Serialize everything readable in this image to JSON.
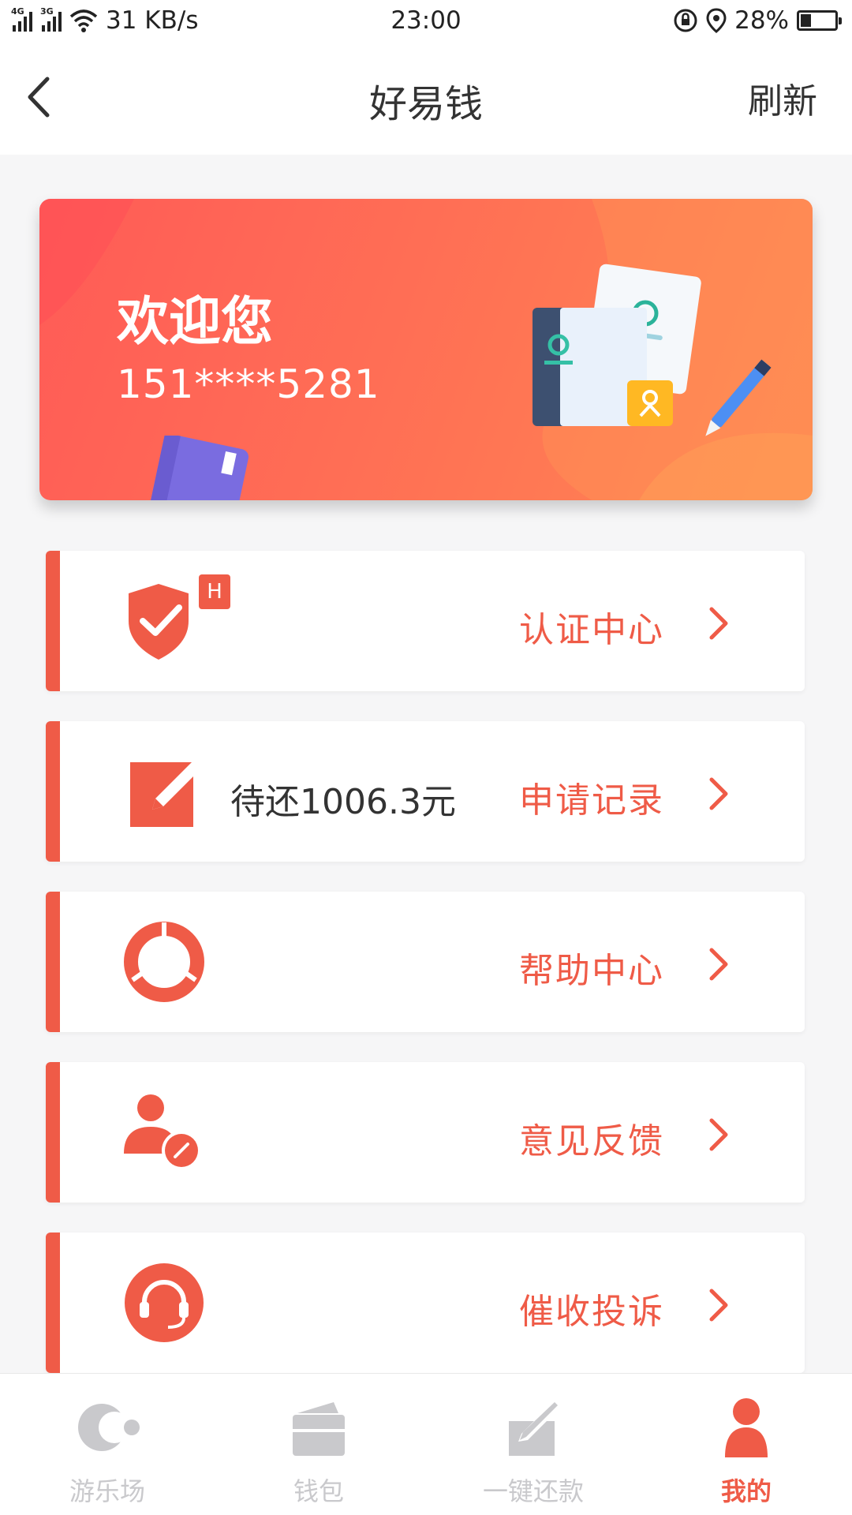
{
  "status_bar": {
    "net1": "4G",
    "net2": "3G",
    "speed": "31 KB/s",
    "time": "23:00",
    "battery": "28%",
    "battery_level": 0.28
  },
  "header": {
    "title": "好易钱",
    "refresh": "刷新"
  },
  "welcome": {
    "greeting": "欢迎您",
    "phone": "151****5281"
  },
  "menu": [
    {
      "label": "认证中心",
      "badge": "H",
      "extra": "",
      "icon": "shield-check-icon"
    },
    {
      "label": "申请记录",
      "extra": "待还1006.3元",
      "icon": "edit-icon"
    },
    {
      "label": "帮助中心",
      "extra": "",
      "icon": "lifebuoy-icon"
    },
    {
      "label": "意见反馈",
      "extra": "",
      "icon": "user-feedback-icon"
    },
    {
      "label": "催收投诉",
      "extra": "",
      "icon": "headset-icon"
    }
  ],
  "nav": [
    {
      "label": "游乐场",
      "icon": "moon-icon",
      "active": false
    },
    {
      "label": "钱包",
      "icon": "wallet-icon",
      "active": false
    },
    {
      "label": "一键还款",
      "icon": "repay-icon",
      "active": false
    },
    {
      "label": "我的",
      "icon": "profile-icon",
      "active": true
    }
  ],
  "colors": {
    "accent": "#ef5b47",
    "nav_inactive": "#c9c9cc",
    "card_gradient_start": "#ff5b57",
    "card_gradient_end": "#ff8752"
  }
}
